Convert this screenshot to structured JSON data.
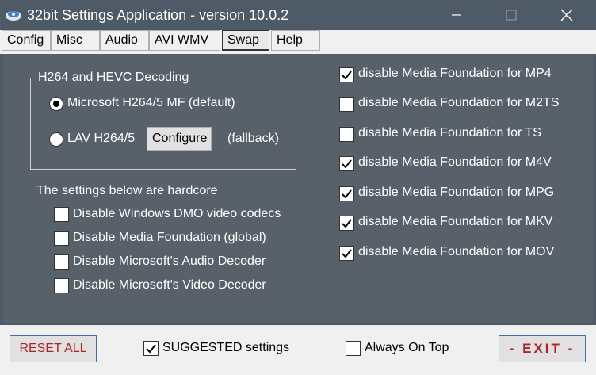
{
  "window": {
    "title": "32bit Settings Application - version 10.0.2"
  },
  "tabs": [
    {
      "label": "Config"
    },
    {
      "label": "Misc"
    },
    {
      "label": "Audio"
    },
    {
      "label": "AVI WMV"
    },
    {
      "label": "Swap",
      "active": true
    },
    {
      "label": "Help"
    }
  ],
  "decoding": {
    "group_title": "H264 and HEVC Decoding",
    "options": [
      {
        "label": "Microsoft H264/5 MF (default)",
        "selected": true
      },
      {
        "label": "LAV H264/5",
        "selected": false
      }
    ],
    "configure_label": "Configure",
    "fallback_label": "(fallback)"
  },
  "hardcore": {
    "heading": "The settings below are hardcore",
    "items": [
      {
        "label": "Disable Windows DMO video codecs",
        "checked": false
      },
      {
        "label": "Disable Media Foundation (global)",
        "checked": false
      },
      {
        "label": "Disable Microsoft's Audio Decoder",
        "checked": false
      },
      {
        "label": "Disable Microsoft's Video Decoder",
        "checked": false
      }
    ]
  },
  "media_foundation": [
    {
      "label": "disable Media Foundation for MP4",
      "checked": true
    },
    {
      "label": "disable Media Foundation for M2TS",
      "checked": false
    },
    {
      "label": "disable Media Foundation for TS",
      "checked": false
    },
    {
      "label": "disable Media Foundation for M4V",
      "checked": true
    },
    {
      "label": "disable Media Foundation for MPG",
      "checked": true
    },
    {
      "label": "disable Media Foundation for MKV",
      "checked": true
    },
    {
      "label": "disable Media Foundation for MOV",
      "checked": true
    }
  ],
  "bottom": {
    "reset_label": "RESET ALL",
    "suggested_label": "SUGGESTED settings",
    "suggested_checked": true,
    "always_on_top_label": "Always On Top",
    "always_on_top_checked": false,
    "exit_label": "- EXIT -"
  },
  "colors": {
    "panel_bg": "#58606a",
    "titlebar_bg": "#4e5a66",
    "button_text_red": "#b22222"
  }
}
